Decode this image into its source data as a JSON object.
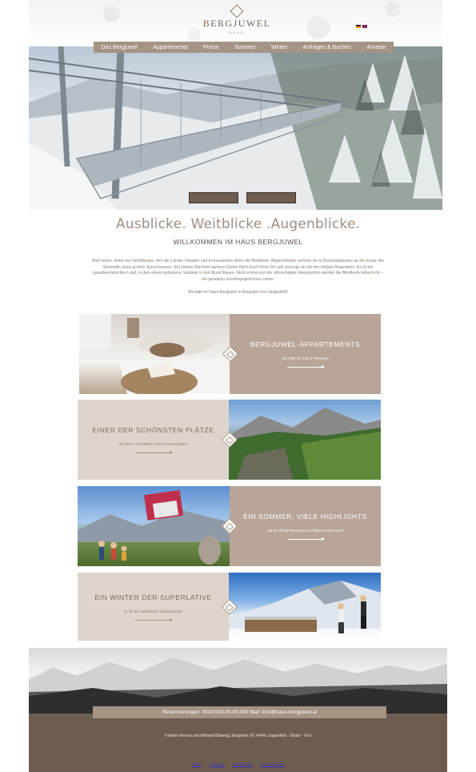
{
  "header": {
    "logo_name": "BERGJUWEL",
    "logo_sub": "HAUS",
    "flags": [
      "de-flag-icon",
      "en-flag-icon"
    ]
  },
  "nav": {
    "items": [
      "Das Bergjuwel",
      "Appartements",
      "Preise",
      "Sommer",
      "Winter",
      "Anfragen & Buchen",
      "Anreise"
    ]
  },
  "hero": {
    "buttons": [
      "",
      ""
    ]
  },
  "intro": {
    "headline": "Ausblicke. Weitblicke .Augenblicke.",
    "welcome": "WILLKOMMEN IM HAUS BERGJUWEL",
    "body": "Weit hinten, hinter den Wortbergen, fern der Länder Vokalien und Konsonantien leben die Blindtexte. Abgeschieden wohnen sie in Buchstabhausen an der Küste des Semantik, eines großen Sprachozeans. Ein kleines Bächlein namens Duden fließt durch ihren Ort und versorgt sie mit den nötigen Regelialien. Es ist ein paradiesmatisches Land, in dem einem gebratene Satzteile in den Mund fliegen. Nicht einmal von der allmächtigen Interpunktion werden die Blindtexte beherrscht – ein geradezu unorthographisches Leben.",
    "sign_off": "Bis bald im Haus Bergjuwel in Burgstein bei Längenfeld!"
  },
  "cards": [
    {
      "title": "BERGJUWEL-APPARTEMENTS",
      "sub": "mit Platz für 2 bis 4 Personen"
    },
    {
      "title": "EINER DER SCHÖNSTEN PLÄTZE",
      "sub": "auf dem 1.400 Meter hohem Sonnenplateu"
    },
    {
      "title": "EIN SOMMER, VIELE HIGHLIGHTS",
      "sub": "mit der Ötztal Premium Card alles in einer Hand"
    },
    {
      "title": "EIN WINTER DER SUPERLATIVE",
      "sub": "im Tal der zahlreichen Dreitausender"
    }
  ],
  "footer": {
    "reservation": "Reservierungen: 0043 000.00.00.000 Mail: info@haus-bergjuwel.at",
    "address": "Familie Verena und Michael Blaisnig, Burgstein 00, 6444 Längenfeld - Ötztal - Tirol",
    "links": [
      "HOME",
      "KONTAKT",
      "IMPRESSUM",
      "DATENSCHUTZ"
    ]
  },
  "colors": {
    "brand": "#a59384",
    "footer": "#6e5c4e",
    "card_dark": "#b9a597",
    "card_light": "#ddd4cc"
  }
}
